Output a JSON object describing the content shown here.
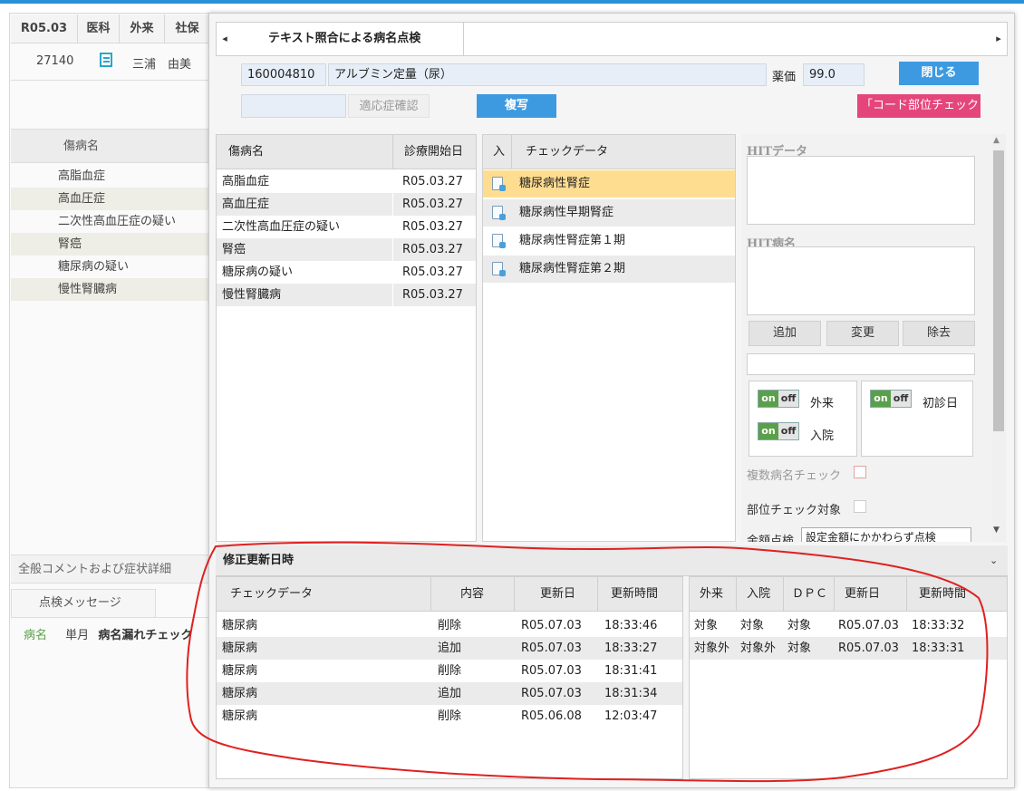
{
  "background": {
    "header_cells": [
      "R05.03",
      "医科",
      "外来",
      "社保"
    ],
    "patient_number": "27140",
    "patient_name": "三浦　由美",
    "disease_header": "傷病名",
    "diseases": [
      "高脂血症",
      "高血圧症",
      "二次性高血圧症の疑い",
      "腎癌",
      "糖尿病の疑い",
      "慢性腎臓病"
    ],
    "comment_label": "全般コメントおよび症状詳細",
    "tab_label": "点検メッセージ",
    "message": {
      "col1": "病名",
      "col2": "単月",
      "col3": "病名漏れチェック"
    }
  },
  "modal": {
    "tab_title": "テキスト照合による病名点検",
    "left_arrow": "◂",
    "right_arrow": "▸",
    "code": "160004810",
    "item_name": "アルブミン定量（尿）",
    "price_label": "薬価",
    "price_value": "99.0",
    "close_button": "閉じる",
    "indication_button": "適応症確認",
    "copy_button": "複写",
    "code_check_button": "「コード部位チェック",
    "disease_table": {
      "headers": [
        "傷病名",
        "診療開始日"
      ],
      "rows": [
        [
          "高脂血症",
          "R05.03.27"
        ],
        [
          "高血圧症",
          "R05.03.27"
        ],
        [
          "二次性高血圧症の疑い",
          "R05.03.27"
        ],
        [
          "腎癌",
          "R05.03.27"
        ],
        [
          "糖尿病の疑い",
          "R05.03.27"
        ],
        [
          "慢性腎臓病",
          "R05.03.27"
        ]
      ]
    },
    "check_table": {
      "headers": [
        "入",
        "チェックデータ"
      ],
      "rows": [
        "糖尿病性腎症",
        "糖尿病性早期腎症",
        "糖尿病性腎症第１期",
        "糖尿病性腎症第２期"
      ]
    },
    "hit_data_label": "HITデータ",
    "hit_name_label": "HIT病名",
    "add_button": "追加",
    "change_button": "変更",
    "remove_button": "除去",
    "toggle_on": "on",
    "toggle_off": "off",
    "outpatient_label": "外来",
    "inpatient_label": "入院",
    "first_visit_label": "初診日",
    "multi_check_label": "複数病名チェック",
    "site_check_label": "部位チェック対象",
    "amount_label": "金額点検",
    "amount_value": "設定金額にかかわらず点検",
    "lower_title": "修正更新日時",
    "history_table": {
      "headers": [
        "チェックデータ",
        "内容",
        "更新日",
        "更新時間"
      ],
      "rows": [
        [
          "糖尿病",
          "削除",
          "R05.07.03",
          "18:33:46"
        ],
        [
          "糖尿病",
          "追加",
          "R05.07.03",
          "18:33:27"
        ],
        [
          "糖尿病",
          "削除",
          "R05.07.03",
          "18:31:41"
        ],
        [
          "糖尿病",
          "追加",
          "R05.07.03",
          "18:31:34"
        ],
        [
          "糖尿病",
          "削除",
          "R05.06.08",
          "12:03:47"
        ]
      ]
    },
    "target_table": {
      "headers": [
        "外来",
        "入院",
        "ＤＰＣ",
        "更新日",
        "更新時間"
      ],
      "rows": [
        [
          "対象",
          "対象",
          "対象",
          "R05.07.03",
          "18:33:32"
        ],
        [
          "対象外",
          "対象外",
          "対象",
          "R05.07.03",
          "18:33:31"
        ]
      ]
    }
  },
  "annotation": {
    "color": "#e02020"
  }
}
